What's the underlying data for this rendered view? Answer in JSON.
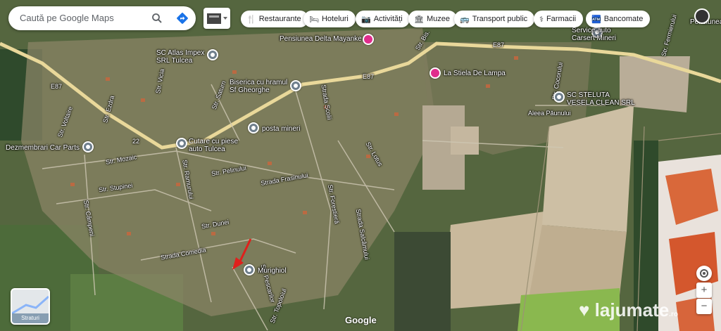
{
  "search": {
    "placeholder": "Caută pe Google Maps"
  },
  "chips": [
    {
      "icon": "restaurant-icon",
      "glyph": "🍴",
      "label": "Restaurante"
    },
    {
      "icon": "hotel-icon",
      "glyph": "🛏",
      "label": "Hoteluri"
    },
    {
      "icon": "camera-icon",
      "glyph": "📷",
      "label": "Activități"
    },
    {
      "icon": "museum-icon",
      "glyph": "🏛",
      "label": "Muzee"
    },
    {
      "icon": "bus-icon",
      "glyph": "🚌",
      "label": "Transport public"
    },
    {
      "icon": "pharmacy-icon",
      "glyph": "⚕",
      "label": "Farmacii"
    },
    {
      "icon": "atm-icon",
      "glyph": "🏧",
      "label": "Bancomate"
    }
  ],
  "places": {
    "atlas": "SC Atlas Impex SRL Tulcea",
    "biserica": "Biserica cu hramul Sf Gheorghe",
    "posta": "posta mineri",
    "cutare": "Cutare cu piese auto Tulcea",
    "dezmembrari": "Dezmembrari Car Parts",
    "pensiunea": "Pensiunea Delta Mayanke",
    "stiela": "La Stiela De Lampa",
    "service": "Service auto Carsert Mineri",
    "steluta": "SC STELUTA VESELA CLEAN SRL",
    "murighiol": "Murighiol",
    "pensiune_right": "Pensiunea"
  },
  "streets": {
    "voltaire": "Str. Voltaire",
    "ezdra": "Str. Ezdra",
    "vicia": "Str. Vicia",
    "saturn": "Str. Saturn",
    "scolii": "Strada Școlii",
    "bisericii": "Str. Bis.",
    "morilor": "Str. Mozaic",
    "ramurului": "Str. Ramurului",
    "pelinului": "Str. Pelinului",
    "stupinei": "Str. Stupinei",
    "campeni": "Str. Câmpeni",
    "frasinului": "Strada Frasinului",
    "lotus": "Str. Lotus",
    "forestiera": "Str. Forestieră",
    "salcamului": "Strada Salcâmului",
    "dunei": "Str. Dunei",
    "comedia": "Strada Comedia",
    "pescarilor": "Str. Pescarilor",
    "topoloiul": "Str. Topoloiul",
    "aleea": "Aleea Păunului",
    "cocorului": "Str. Cocorului",
    "fermierului": "Str. Fermierului"
  },
  "roads": {
    "e87_a": "E87",
    "e87_b": "E87",
    "e87_c": "E87",
    "r22": "22"
  },
  "strat_label": "Straturi",
  "controls": {
    "zoom_in": "+",
    "zoom_out": "−"
  },
  "attribution": "Google",
  "watermark": {
    "text": "lajumate",
    "suffix": ".ro"
  },
  "colors": {
    "pin_pink": "#e02d8c",
    "road": "#e9d89a",
    "accent_blue": "#1a73e8"
  }
}
